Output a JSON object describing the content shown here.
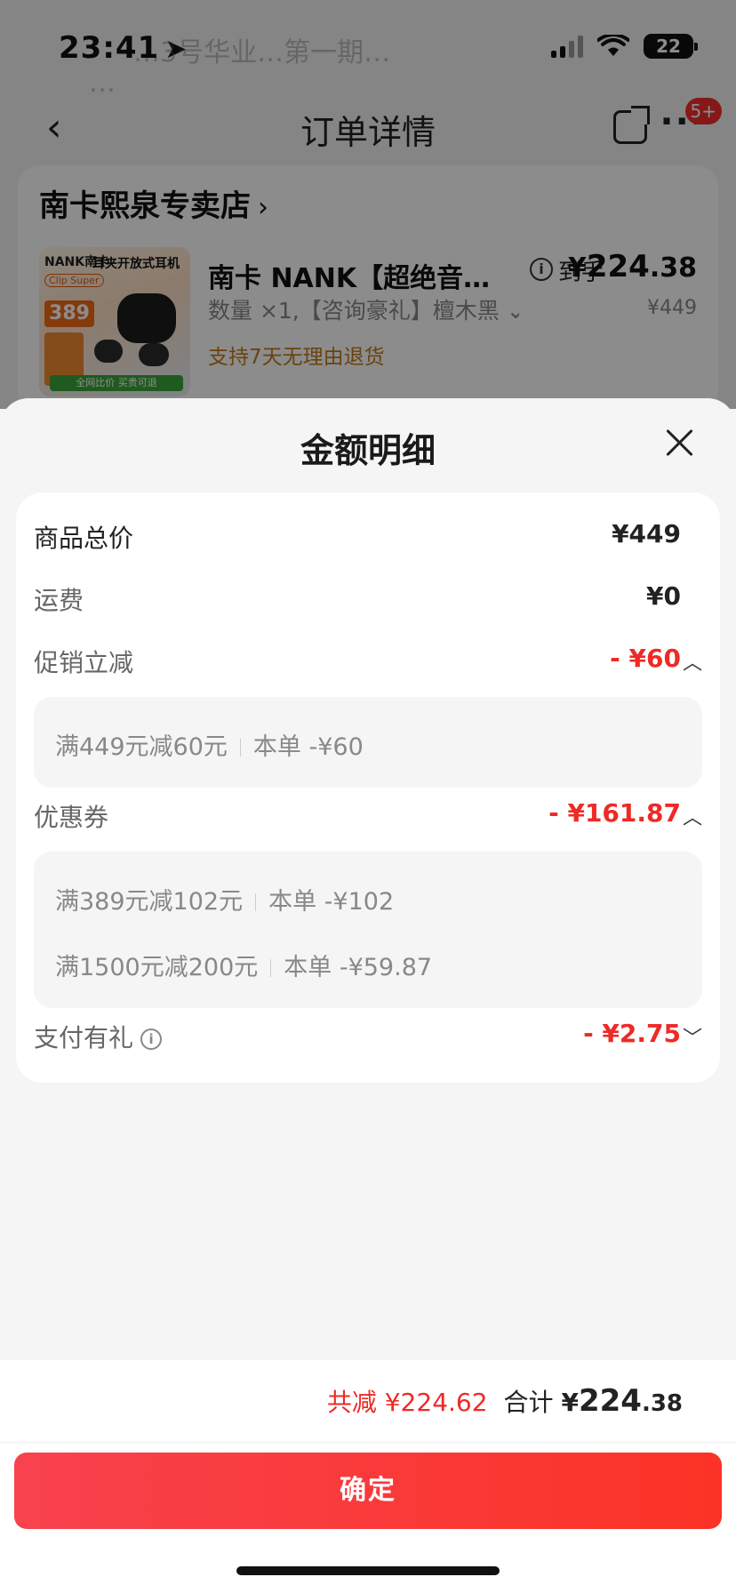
{
  "status_bar": {
    "time": "23:41",
    "battery": "22"
  },
  "background": {
    "ghost_line1": "…3号华业…第一期…",
    "ghost_line2": "…"
  },
  "nav": {
    "title": "订单详情",
    "badge": "5+"
  },
  "store": {
    "name": "南卡熙泉专卖店",
    "product": {
      "title": "南卡 NANK【超绝音质…",
      "daoshou_label": "到手",
      "price_currency": "¥",
      "price_int": "224",
      "price_dec": ".38",
      "quantity": "数量 ×1,【咨询豪礼】檀木黑",
      "original_price": "¥449",
      "return_policy": "支持7天无理由退货",
      "image_labels": {
        "brand": "NANK南卡",
        "headline": "耳夹开放式耳机",
        "tag": "Clip Super",
        "price": "389",
        "bottom": "全网比价 买贵可退"
      }
    }
  },
  "sheet": {
    "title": "金额明细",
    "rows": {
      "goods_total": {
        "label": "商品总价",
        "value": "¥449"
      },
      "shipping": {
        "label": "运费",
        "value": "¥0"
      },
      "promo": {
        "label": "促销立减",
        "value": "- ¥60"
      },
      "coupon": {
        "label": "优惠券",
        "value": "- ¥161.87"
      },
      "pay_gift": {
        "label": "支付有礼",
        "value": "- ¥2.75"
      }
    },
    "promo_details": [
      {
        "rule": "满449元减60元",
        "amount": "本单 -¥60"
      }
    ],
    "coupon_details": [
      {
        "rule": "满389元减102元",
        "amount": "本单 -¥102"
      },
      {
        "rule": "满1500元减200元",
        "amount": "本单 -¥59.87"
      }
    ]
  },
  "footer": {
    "reduce": "共减 ¥224.62",
    "total_label": "合计",
    "total_currency": "¥",
    "total_int": "224",
    "total_dec": ".38",
    "confirm": "确定"
  },
  "colors": {
    "accent_red": "#ee2a26",
    "button_gradient_start": "#f8424e",
    "button_gradient_end": "#fb3326",
    "return_policy": "#c07a1d"
  }
}
